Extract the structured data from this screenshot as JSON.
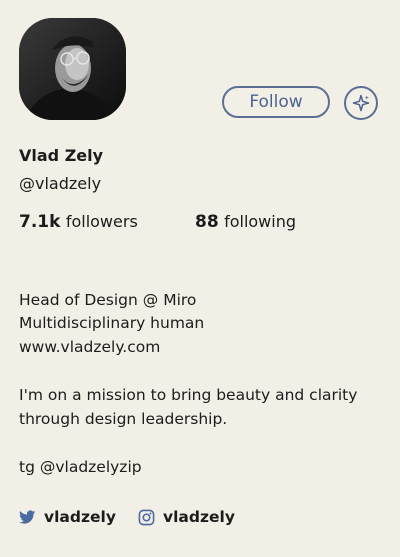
{
  "profile": {
    "name": "Vlad Zely",
    "handle": "@vladzely",
    "follow_label": "Follow"
  },
  "stats": {
    "followers_count": "7.1k",
    "followers_label": "followers",
    "following_count": "88",
    "following_label": "following"
  },
  "bio": {
    "line1": "Head of Design @ Miro",
    "line2": "Multidisciplinary human",
    "line3": "www.vladzely.com",
    "line4": "I'm on a mission to bring beauty and clarity",
    "line5": "through design leadership.",
    "line6": "tg @vladzelyzip"
  },
  "social": {
    "twitter": {
      "icon": "twitter-icon",
      "label": "vladzely"
    },
    "instagram": {
      "icon": "instagram-icon",
      "label": "vladzely"
    }
  },
  "colors": {
    "background": "#f2efe6",
    "accent": "#4d6390",
    "text": "#1c1c1c"
  }
}
